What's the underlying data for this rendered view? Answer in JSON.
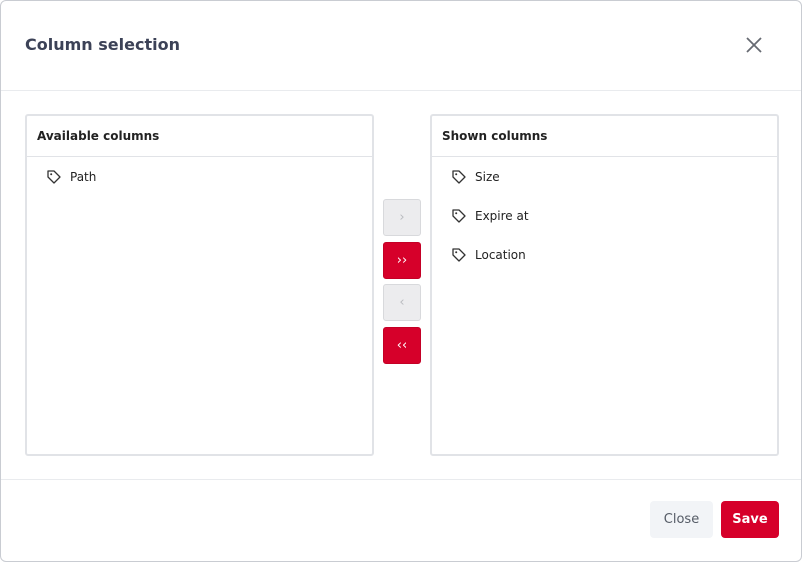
{
  "dialog": {
    "title": "Column selection",
    "close_label": "Close",
    "save_label": "Save"
  },
  "available": {
    "heading": "Available columns",
    "items": [
      "Path"
    ]
  },
  "shown": {
    "heading": "Shown columns",
    "items": [
      "Size",
      "Expire at",
      "Location"
    ]
  },
  "transfer": {
    "move_right_glyph": "›",
    "move_all_right_glyph": "››",
    "move_left_glyph": "‹",
    "move_all_left_glyph": "‹‹"
  },
  "colors": {
    "accent": "#d6002a",
    "disabled": "#ececee"
  },
  "icons": {
    "item_icon": "tag-icon",
    "close_icon": "close-icon"
  }
}
